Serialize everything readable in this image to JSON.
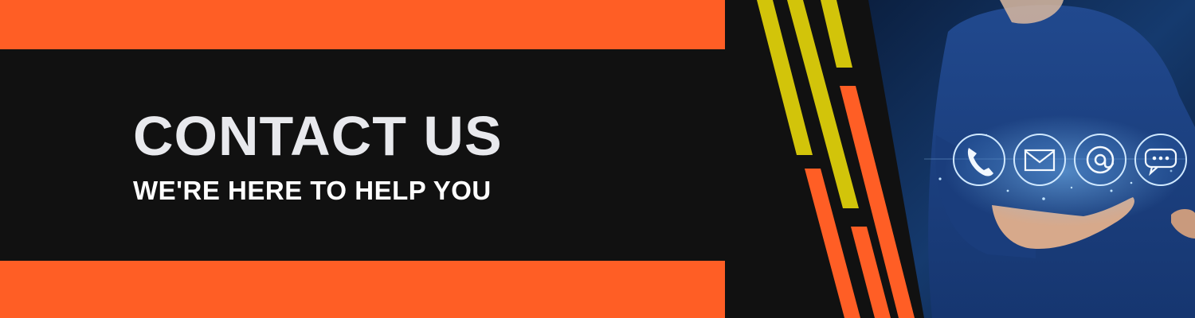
{
  "banner": {
    "title": "CONTACT US",
    "subtitle": "WE'RE HERE TO HELP YOU"
  },
  "contact_icons": [
    {
      "name": "phone-icon"
    },
    {
      "name": "mail-icon"
    },
    {
      "name": "at-sign-icon"
    },
    {
      "name": "chat-icon"
    }
  ],
  "colors": {
    "background": "#111111",
    "accent_orange": "#ff5e25",
    "accent_yellow": "#d2c40a",
    "title_text": "#e8e9ed",
    "photo_blue": "#1b3f7c"
  }
}
